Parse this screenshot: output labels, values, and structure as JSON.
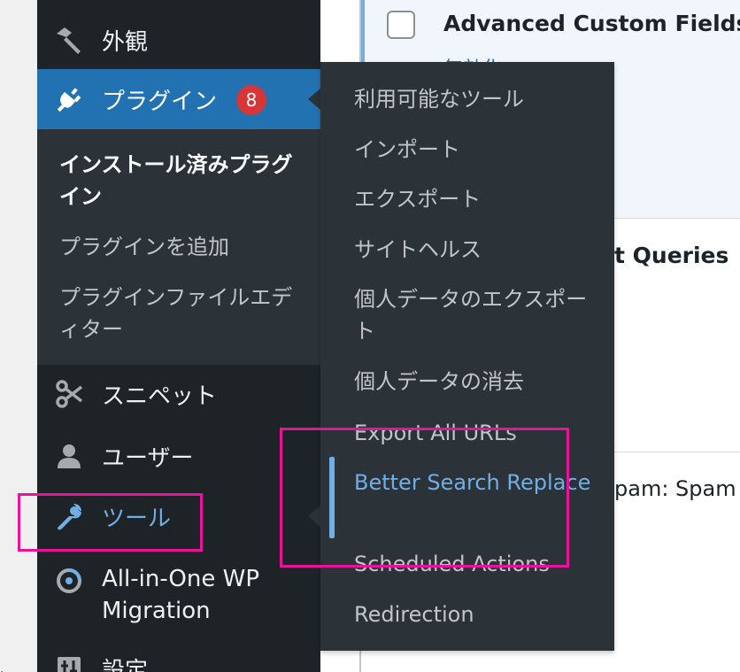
{
  "colors": {
    "sidebar_bg": "#1d2327",
    "submenu_bg": "#2c3338",
    "accent": "#2271b1",
    "link_hover": "#72aee6",
    "badge": "#d63638",
    "highlight": "#e8139b"
  },
  "sidebar": {
    "appearance": {
      "label": "外観",
      "icon": "paintbrush-icon"
    },
    "plugins": {
      "label": "プラグイン",
      "icon": "plugin-icon",
      "badge": "8",
      "submenu": [
        {
          "label": "インストール済みプラグイン",
          "current": true
        },
        {
          "label": "プラグインを追加"
        },
        {
          "label": "プラグインファイルエディター"
        }
      ]
    },
    "snippets": {
      "label": "スニペット",
      "icon": "scissors-icon"
    },
    "users": {
      "label": "ユーザー",
      "icon": "user-icon"
    },
    "tools": {
      "label": "ツール",
      "icon": "wrench-icon"
    },
    "aio_migration": {
      "label": "All-in-One WP Migration",
      "icon": "migration-icon"
    },
    "settings": {
      "label": "設定",
      "icon": "settings-icon"
    }
  },
  "tools_flyout": {
    "items": [
      {
        "label": "利用可能なツール"
      },
      {
        "label": "インポート"
      },
      {
        "label": "エクスポート"
      },
      {
        "label": "サイトヘルス"
      },
      {
        "label": "個人データのエクスポート"
      },
      {
        "label": "個人データの消去"
      },
      {
        "label": "Export All URLs"
      },
      {
        "label": "Better Search Replace",
        "current": true
      },
      {
        "label": "Scheduled Actions"
      },
      {
        "label": "Redirection"
      }
    ]
  },
  "plugin_list": {
    "row1": {
      "name": "Advanced Custom Fields",
      "action": "無効化"
    },
    "row2": {
      "name": "t Queries"
    },
    "row3": {
      "name": "pam: Spam"
    }
  }
}
